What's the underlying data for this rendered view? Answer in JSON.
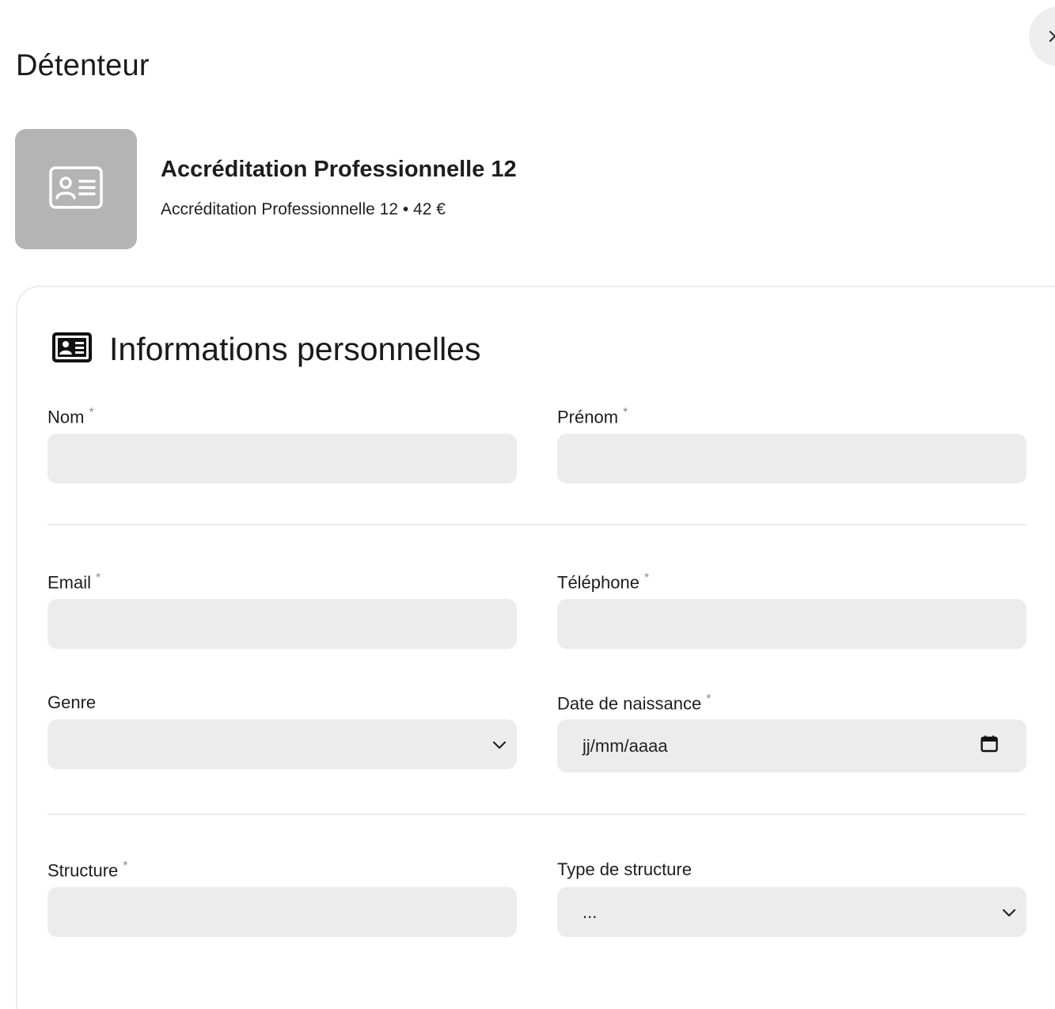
{
  "header": {
    "title": "Détenteur",
    "close_label": "×"
  },
  "product": {
    "name": "Accréditation Professionnelle 12",
    "subtitle": "Accréditation Professionnelle 12 • 42 €",
    "icon": "id-card-icon"
  },
  "section": {
    "title": "Informations personnelles",
    "icon": "id-card-icon"
  },
  "fields": {
    "nom": {
      "label": "Nom",
      "required": "*",
      "value": ""
    },
    "prenom": {
      "label": "Prénom",
      "required": "*",
      "value": ""
    },
    "email": {
      "label": "Email",
      "required": "*",
      "value": ""
    },
    "telephone": {
      "label": "Téléphone",
      "required": "*",
      "value": ""
    },
    "genre": {
      "label": "Genre",
      "value": ""
    },
    "date_naissance": {
      "label": "Date de naissance",
      "required": "*",
      "placeholder": "jj/mm/aaaa"
    },
    "structure": {
      "label": "Structure",
      "required": "*",
      "value": ""
    },
    "type_structure": {
      "label": "Type de structure",
      "value": "..."
    }
  },
  "colors": {
    "field_bg": "#ececec",
    "thumb_bg": "#b4b4b4",
    "divider": "#ececec"
  }
}
